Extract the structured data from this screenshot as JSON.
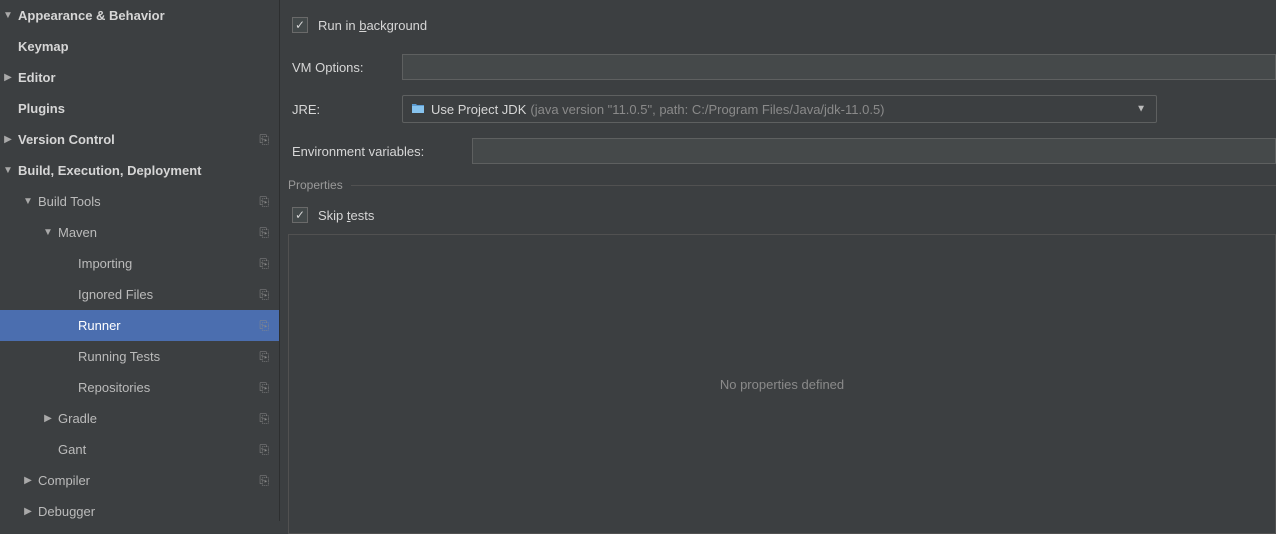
{
  "sidebar": {
    "items": [
      {
        "label": "Appearance & Behavior",
        "arrow": "down",
        "indent": 0,
        "bold": true,
        "doc": false,
        "selected": false,
        "visible": false
      },
      {
        "label": "Keymap",
        "arrow": "none",
        "indent": 0,
        "bold": true,
        "doc": false,
        "selected": false
      },
      {
        "label": "Editor",
        "arrow": "right",
        "indent": 0,
        "bold": true,
        "doc": false,
        "selected": false
      },
      {
        "label": "Plugins",
        "arrow": "none",
        "indent": 0,
        "bold": true,
        "doc": false,
        "selected": false
      },
      {
        "label": "Version Control",
        "arrow": "right",
        "indent": 0,
        "bold": true,
        "doc": true,
        "selected": false
      },
      {
        "label": "Build, Execution, Deployment",
        "arrow": "down",
        "indent": 0,
        "bold": true,
        "doc": false,
        "selected": false
      },
      {
        "label": "Build Tools",
        "arrow": "down",
        "indent": 1,
        "bold": false,
        "doc": true,
        "selected": false
      },
      {
        "label": "Maven",
        "arrow": "down",
        "indent": 2,
        "bold": false,
        "doc": true,
        "selected": false
      },
      {
        "label": "Importing",
        "arrow": "none",
        "indent": 3,
        "bold": false,
        "doc": true,
        "selected": false
      },
      {
        "label": "Ignored Files",
        "arrow": "none",
        "indent": 3,
        "bold": false,
        "doc": true,
        "selected": false
      },
      {
        "label": "Runner",
        "arrow": "none",
        "indent": 3,
        "bold": false,
        "doc": true,
        "selected": true
      },
      {
        "label": "Running Tests",
        "arrow": "none",
        "indent": 3,
        "bold": false,
        "doc": true,
        "selected": false
      },
      {
        "label": "Repositories",
        "arrow": "none",
        "indent": 3,
        "bold": false,
        "doc": true,
        "selected": false
      },
      {
        "label": "Gradle",
        "arrow": "right",
        "indent": 2,
        "bold": false,
        "doc": true,
        "selected": false
      },
      {
        "label": "Gant",
        "arrow": "none",
        "indent": 2,
        "bold": false,
        "doc": true,
        "selected": false
      },
      {
        "label": "Compiler",
        "arrow": "right",
        "indent": 1,
        "bold": false,
        "doc": true,
        "selected": false
      },
      {
        "label": "Debugger",
        "arrow": "right",
        "indent": 1,
        "bold": false,
        "doc": false,
        "selected": false
      }
    ]
  },
  "main": {
    "run_in_background_pre": "Run in ",
    "run_in_background_u": "b",
    "run_in_background_post": "ackground",
    "vm_options_label": "VM Options:",
    "vm_options_value": "",
    "jre_label": "JRE:",
    "jre_value": "Use Project JDK",
    "jre_hint": "(java version \"11.0.5\", path: C:/Program Files/Java/jdk-11.0.5)",
    "env_label": "Environment variables:",
    "env_value": "",
    "properties_header": "Properties",
    "skip_tests_pre": "Skip ",
    "skip_tests_u": "t",
    "skip_tests_post": "ests",
    "empty_text": "No properties defined"
  }
}
